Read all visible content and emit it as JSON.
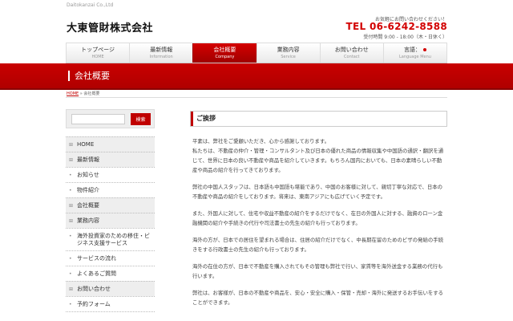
{
  "header": {
    "company_en": "Daitokanzai Co.,Ltd",
    "logo": "大東管財株式会社",
    "contact_note": "お気軽にお問い合わせください！",
    "tel": "TEL 06-6242-8588",
    "hours": "受付時間 9:00 - 18:00（木・日休く）"
  },
  "nav": {
    "items": [
      {
        "jp": "トップページ",
        "en": "HOME"
      },
      {
        "jp": "最新情報",
        "en": "Information"
      },
      {
        "jp": "会社概要",
        "en": "Company"
      },
      {
        "jp": "業務内容",
        "en": "Service"
      },
      {
        "jp": "お問い合わせ",
        "en": "Contact"
      },
      {
        "jp": "言語：",
        "en": "Language Menu"
      }
    ],
    "active_index": 2
  },
  "banner": {
    "title": "会社概要"
  },
  "breadcrumb": {
    "home": "HOME",
    "separator": "»",
    "current": "会社概要"
  },
  "search": {
    "placeholder": "",
    "button": "検索"
  },
  "sidemenu": {
    "items": [
      {
        "mark": "⊞",
        "label": "HOME"
      },
      {
        "mark": "⊞",
        "label": "最新情報"
      },
      {
        "mark": "•",
        "label": "お知らせ"
      },
      {
        "mark": "•",
        "label": "物件紹介"
      },
      {
        "mark": "⊞",
        "label": "会社概要"
      },
      {
        "mark": "⊞",
        "label": "業務内容"
      },
      {
        "mark": "•",
        "label": "海外投資家のための移住・ビジネス支援サービス"
      },
      {
        "mark": "•",
        "label": "サービスの流れ"
      },
      {
        "mark": "•",
        "label": "よくあるご質問"
      },
      {
        "mark": "⊞",
        "label": "お問い合わせ"
      },
      {
        "mark": "•",
        "label": "予約フォーム"
      }
    ]
  },
  "content": {
    "title": "ご挨拶",
    "paragraphs": [
      "平素は、弊社をご愛顧いただき、心から感謝しております。\n私たちは、不動産の仲介・管理・コンサルタント及び日本の優れた商品の情報収集や中国語の通訳・翻訳を通じて、世界に日本の良い不動産や商品を紹介していきます。もちろん国内においても、日本の素晴らしい不動産や商品の紹介を行ってきております。",
      "弊社の中国人スタッフは、日本語も中国語も堪能であり、中国のお客様に対して、親切丁寧な対応で、日本の不動産や商品の紹介をしております。将来は、東南アジアにも広げていく予定です。",
      "また、外国人に対して、住宅や収益不動産の紹介をするだけでなく、在日の外国人に対する、融資のローン金融機関の紹介や手続きの代行や司法書士の先生の紹介も行っております。",
      "海外の方が、日本での居住を望まれる場合は、住居の紹介だけでなく、中長期在留のためのビザの発給の手続きをする行政書士の先生の紹介も行っております。",
      "海外の在住の方が、日本で不動産を購入されてもその管理も弊社で行い、家賃等を海外送金する業務の代行も行います。",
      "弊社は、お客様が、日本の不動産や商品を、安心・安全に購入・保管・売却・海外に発送するお手伝いをすることができます。"
    ]
  }
}
